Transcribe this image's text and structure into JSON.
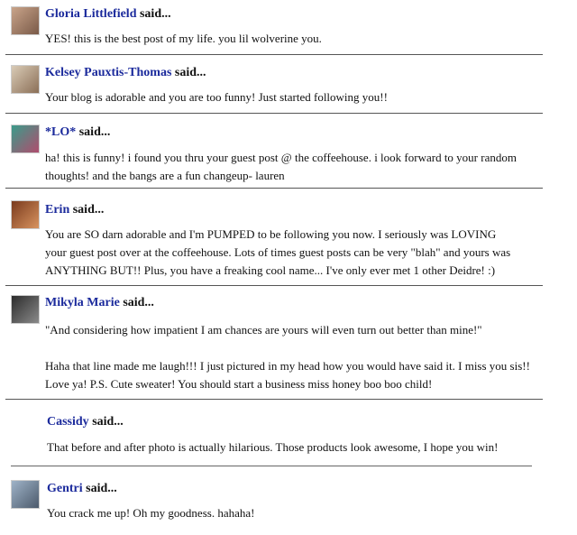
{
  "said_label": "said...",
  "comments": [
    {
      "author": "Gloria Littlefield",
      "lines": [
        "YES! this is the best post of my life. you lil wolverine you."
      ]
    },
    {
      "author": "Kelsey Pauxtis-Thomas",
      "lines": [
        "Your blog is adorable and you are too funny! Just started following you!!"
      ]
    },
    {
      "author": "*LO*",
      "lines": [
        "ha! this is funny! i found you thru your guest post @ the coffeehouse. i look forward to your random",
        "thoughts! and the bangs are a fun changeup- lauren"
      ]
    },
    {
      "author": "Erin",
      "lines": [
        "You are SO darn adorable and I'm PUMPED to be following you now. I seriously was LOVING",
        "your guest post over at the coffeehouse. Lots of times guest posts can be very \"blah\" and yours was",
        "ANYTHING BUT!! Plus, you have a freaking cool name... I've only ever met 1 other Deidre! :)"
      ]
    },
    {
      "author": "Mikyla Marie",
      "lines": [
        "\"And considering how impatient I am chances are yours will even turn out better than mine!\"",
        "",
        "Haha that line made me laugh!!! I just pictured in my head how you would have said it. I miss you sis!!",
        "Love ya! P.S. Cute sweater! You should start a business miss honey boo boo child!"
      ]
    },
    {
      "author": "Cassidy",
      "lines": [
        "That before and after photo is actually hilarious. Those products look awesome, I hope you win!"
      ]
    },
    {
      "author": "Gentri",
      "lines": [
        "You crack me up! Oh my goodness. hahaha!"
      ]
    }
  ]
}
